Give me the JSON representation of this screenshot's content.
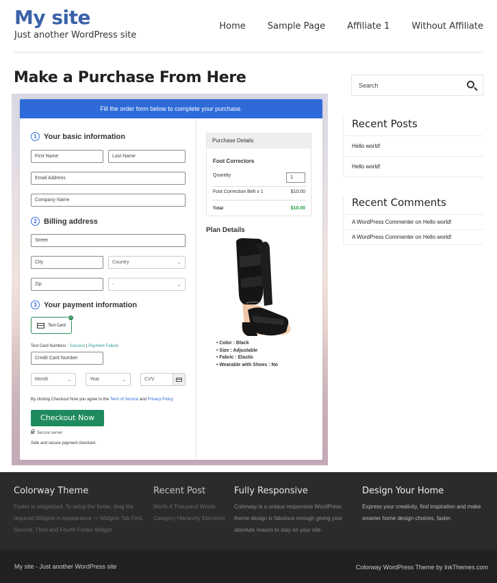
{
  "site": {
    "title": "My site",
    "tagline": "Just another WordPress site"
  },
  "nav": {
    "items": [
      "Home",
      "Sample Page",
      "Affiliate 1",
      "Without Affiliate"
    ]
  },
  "page": {
    "title": "Make a Purchase From Here"
  },
  "form": {
    "banner": "Fill the order form below to complete your purchase.",
    "section1": {
      "num": "1",
      "title": "Your basic information"
    },
    "first_name": "First Name",
    "last_name": "Last Name",
    "email": "Email Address",
    "company": "Company Name",
    "section2": {
      "num": "2",
      "title": "Billing address"
    },
    "street": "Street",
    "city": "City",
    "country": "Country",
    "zip": "Zip",
    "state": "-",
    "section3": {
      "num": "3",
      "title": "Your payment information"
    },
    "test_card_label": "Test Card",
    "test_numbers_prefix": "Test Card Numbers : ",
    "test_success": "Success",
    "test_sep": " | ",
    "test_failure": "Payment Failure",
    "card_number": "Credit Card Number",
    "month": "Month",
    "year": "Year",
    "cvv": "CVV",
    "agree_prefix": "By clicking Checkout Now you agree to the ",
    "agree_terms": "Term of Service",
    "agree_and": " and ",
    "agree_privacy": "Privacy Policy",
    "checkout_button": "Checkout Now",
    "secure_server": "Secure server",
    "safe_text": "Safe and secure payment checkout."
  },
  "purchase": {
    "header": "Purchase Details",
    "product_name": "Foot Correctors",
    "quantity_label": "Quantity",
    "quantity_value": "1",
    "line_item": "Foot Correction Belt x 1",
    "line_price": "$10.00",
    "total_label": "Total",
    "total_value": "$10.00",
    "total_color": "#1f9d3a"
  },
  "plan": {
    "title": "Plan Details",
    "features": [
      "Color : Black",
      "Size : Adjustable",
      "Fabric : Elastic",
      "Wearable with Shoes : No"
    ]
  },
  "sidebar": {
    "search_placeholder": "Search",
    "recent_posts_title": "Recent Posts",
    "recent_posts": [
      "Hello world!",
      "Hello world!"
    ],
    "recent_comments_title": "Recent Comments",
    "comment_author": "A WordPress Commenter",
    "comment_on": " on ",
    "comment_post": "Hello world!"
  },
  "footer": {
    "col1": {
      "title": "Colorway Theme",
      "text": "Footer is widgetized. To setup the footer, drag the required Widgets in Appearance -> Widgets Tab First, Second, Third and Fourth Footer Widget"
    },
    "col2": {
      "title": "Recent Post",
      "text": "Worth A Thousand Words Category Hierarchy Elements"
    },
    "col3": {
      "title": "Fully Responsive",
      "text": "Colorway is a unique responsive WordPress theme design is fabulous enough giving your absolute reason to stay on your site."
    },
    "col4": {
      "title": "Design Your Home",
      "text": "Express your creativity, find inspiration and make smarter home design choices, faster."
    },
    "bottom_left": "My site - Just another WordPress site",
    "bottom_right": "Colorway WordPress Theme by InkThemes.com"
  },
  "colors": {
    "brand_blue": "#3a62a8",
    "banner_blue": "#2f6ad9",
    "checkout_green": "#1f8a5e",
    "footer_bg": "#2b2b2b"
  }
}
